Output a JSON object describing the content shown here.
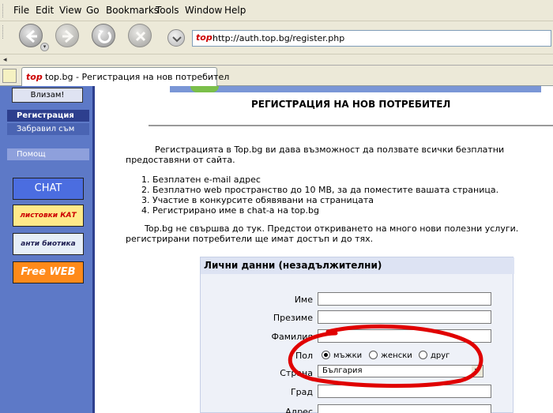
{
  "menu": {
    "items": [
      {
        "label": "File",
        "key": "F"
      },
      {
        "label": "Edit",
        "key": "E"
      },
      {
        "label": "View",
        "key": "V"
      },
      {
        "label": "Go",
        "key": "G"
      },
      {
        "label": "Bookmarks",
        "key": "B"
      },
      {
        "label": "Tools",
        "key": "T"
      },
      {
        "label": "Window",
        "key": "W"
      },
      {
        "label": "Help",
        "key": "H"
      }
    ]
  },
  "toolbar": {
    "url": "http://auth.top.bg/register.php",
    "url_logo": "top"
  },
  "tab": {
    "logo": "top",
    "title": "top.bg - Регистрация на нов потребител"
  },
  "sidebar": {
    "login_button": "Влизам!",
    "items": [
      {
        "label": "Регистрация"
      },
      {
        "label": "Забравил съм"
      },
      {
        "label": "Помощ"
      }
    ],
    "ads": [
      {
        "label": "CHAT"
      },
      {
        "label": "листовки КАТ"
      },
      {
        "label": "анти биотика"
      },
      {
        "label": "Free WEB"
      }
    ]
  },
  "page": {
    "title": "РЕГИСТРАЦИЯ НА НОВ ПОТРЕБИТЕЛ",
    "intro_line1": "Регистрацията в Top.bg ви дава възможност да ползвате всички безплатни",
    "intro_line2": "предоставяни от сайта.",
    "benefits": [
      "1.  Безплатен e-mail адрес",
      "2.  Безплатно web пространство до 10 MB, за да поместите вашата страница.",
      "3.  Участие в конкурсите обявявани на страницата",
      "4.  Регистрирано име в chat-а на top.bg"
    ],
    "outro_line1": "Top.bg не свършва до тук. Предстои откриването на много нови полезни услуги.",
    "outro_line2": "регистрирани потребители ще имат достъп и до тях."
  },
  "form": {
    "header": "Лични данни (незадължителни)",
    "fields": {
      "first_name": "Име",
      "middle_name": "Презиме",
      "last_name": "Фамилия",
      "gender": "Пол",
      "country": "Страна",
      "city": "Град",
      "address": "Адрес"
    },
    "gender_options": [
      "мъжки",
      "женски",
      "друг"
    ],
    "gender_selected": "мъжки",
    "country_value": "България"
  },
  "colors": {
    "sidebar_bg": "#5d79c7",
    "sidebar_active": "#2d3f8e",
    "annotation": "#e00000"
  }
}
